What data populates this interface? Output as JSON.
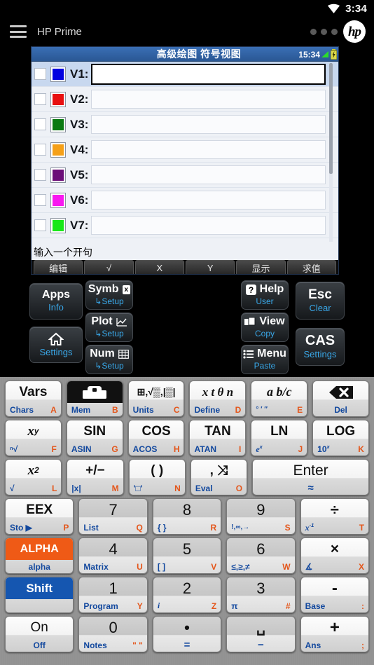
{
  "status_bar": {
    "time": "3:34",
    "wifi_icon": "wifi-icon"
  },
  "app_bar": {
    "menu_icon": "hamburger-menu-icon",
    "title": "HP Prime",
    "overflow_icon": "overflow-dots-icon",
    "logo_text": "hp"
  },
  "lcd": {
    "title": "高级绘图 符号视图",
    "clock": "15:34",
    "signal_icon": "signal-bars-icon",
    "battery_icon": "battery-charging-icon",
    "status_text": "输入一个开句",
    "rows": [
      {
        "label": "V1:",
        "color": "#0000e0",
        "value": "",
        "selected": true
      },
      {
        "label": "V2:",
        "color": "#e81010",
        "value": "",
        "selected": false
      },
      {
        "label": "V3:",
        "color": "#0a7a12",
        "value": "",
        "selected": false
      },
      {
        "label": "V4:",
        "color": "#f5a018",
        "value": "",
        "selected": false
      },
      {
        "label": "V5:",
        "color": "#6b0e78",
        "value": "",
        "selected": false
      },
      {
        "label": "V6:",
        "color": "#f818f0",
        "value": "",
        "selected": false
      },
      {
        "label": "V7:",
        "color": "#18e818",
        "value": "",
        "selected": false
      }
    ],
    "softkeys": [
      "编辑",
      "√",
      "X",
      "Y",
      "显示",
      "求值"
    ]
  },
  "deck": {
    "apps": {
      "main": "Apps",
      "sub": "Info"
    },
    "home": {
      "main": "home-icon",
      "sub": "Settings"
    },
    "symb": {
      "main": "Symb",
      "badge": "x",
      "sub": "↳Setup"
    },
    "plot": {
      "main": "Plot",
      "icon": "plot-graph-icon",
      "sub": "↳Setup"
    },
    "num": {
      "main": "Num",
      "icon": "table-grid-icon",
      "sub": "↳Setup"
    },
    "help": {
      "main": "Help",
      "icon": "help-question-icon",
      "sub": "User"
    },
    "view": {
      "main": "View",
      "icon": "view-windows-icon",
      "sub": "Copy"
    },
    "menu": {
      "main": "Menu",
      "icon": "menu-list-icon",
      "sub": "Paste"
    },
    "esc": {
      "main": "Esc",
      "sub": "Clear"
    },
    "cas": {
      "main": "CAS",
      "sub": "Settings"
    }
  },
  "keypad": {
    "rows": [
      [
        {
          "name": "vars",
          "top": "Vars",
          "left": "Chars",
          "right": "A"
        },
        {
          "name": "mem",
          "top": "toolbox-icon",
          "left": "Mem",
          "right": "B",
          "style": "mem"
        },
        {
          "name": "units",
          "top": "units-icon",
          "left": "Units",
          "right": "C"
        },
        {
          "name": "define",
          "top": "x t θ n",
          "left": "Define",
          "right": "D"
        },
        {
          "name": "fraction",
          "top": "a b/c",
          "left": "° ′ ″",
          "right": "E"
        },
        {
          "name": "del",
          "top": "backspace-icon",
          "center": "Del"
        }
      ],
      [
        {
          "name": "power",
          "top": "x^y",
          "left": "ⁿ√",
          "right": "F"
        },
        {
          "name": "sin",
          "top": "SIN",
          "left": "ASIN",
          "right": "G"
        },
        {
          "name": "cos",
          "top": "COS",
          "left": "ACOS",
          "right": "H"
        },
        {
          "name": "tan",
          "top": "TAN",
          "left": "ATAN",
          "right": "I"
        },
        {
          "name": "ln",
          "top": "LN",
          "left": "e^x",
          "right": "J"
        },
        {
          "name": "log",
          "top": "LOG",
          "left": "10^x",
          "right": "K"
        }
      ],
      [
        {
          "name": "square",
          "top": "x²",
          "left": "√",
          "right": "L"
        },
        {
          "name": "negate",
          "top": "+/−",
          "left": "|x|",
          "right": "M"
        },
        {
          "name": "parens",
          "top": "( )",
          "left": "'□'",
          "right": "N"
        },
        {
          "name": "comma",
          "top": ", ⤨",
          "left": "Eval",
          "right": "O"
        },
        {
          "name": "enter",
          "top": "Enter",
          "center": "≈",
          "wide": true
        }
      ],
      [
        {
          "name": "eex",
          "top": "EEX",
          "left": "Sto ▶",
          "right": "P"
        },
        {
          "name": "seven",
          "top": "7",
          "left": "List",
          "right": "Q",
          "style": "num"
        },
        {
          "name": "eight",
          "top": "8",
          "left": "{ }",
          "right": "R",
          "style": "num"
        },
        {
          "name": "nine",
          "top": "9",
          "left": "!,∞,→",
          "right": "S",
          "style": "num"
        },
        {
          "name": "divide",
          "top": "÷",
          "left": "x⁻¹",
          "right": "T"
        }
      ],
      [
        {
          "name": "alpha",
          "top": "ALPHA",
          "center": "alpha",
          "style": "alpha"
        },
        {
          "name": "four",
          "top": "4",
          "left": "Matrix",
          "right": "U",
          "style": "num"
        },
        {
          "name": "five",
          "top": "5",
          "left": "[ ]",
          "right": "V",
          "style": "num"
        },
        {
          "name": "six",
          "top": "6",
          "left": "≤,≥,≠",
          "right": "W",
          "style": "num"
        },
        {
          "name": "multiply",
          "top": "×",
          "left": "∡",
          "right": "X"
        }
      ],
      [
        {
          "name": "shift",
          "top": "Shift",
          "style": "shift"
        },
        {
          "name": "one",
          "top": "1",
          "left": "Program",
          "right": "Y",
          "style": "num"
        },
        {
          "name": "two",
          "top": "2",
          "left": "i",
          "right": "Z",
          "style": "num"
        },
        {
          "name": "three",
          "top": "3",
          "left": "π",
          "right": "#",
          "style": "num"
        },
        {
          "name": "minus",
          "top": "-",
          "left": "Base",
          "right": ":"
        }
      ],
      [
        {
          "name": "on",
          "top": "On",
          "center": "Off"
        },
        {
          "name": "zero",
          "top": "0",
          "left": "Notes",
          "right": "\" \"",
          "style": "num"
        },
        {
          "name": "decimal",
          "top": "•",
          "center": "=",
          "style": "num"
        },
        {
          "name": "space",
          "top": "␣",
          "center": "−",
          "style": "num"
        },
        {
          "name": "plus",
          "top": "+",
          "left": "Ans",
          "right": ";"
        }
      ]
    ]
  }
}
